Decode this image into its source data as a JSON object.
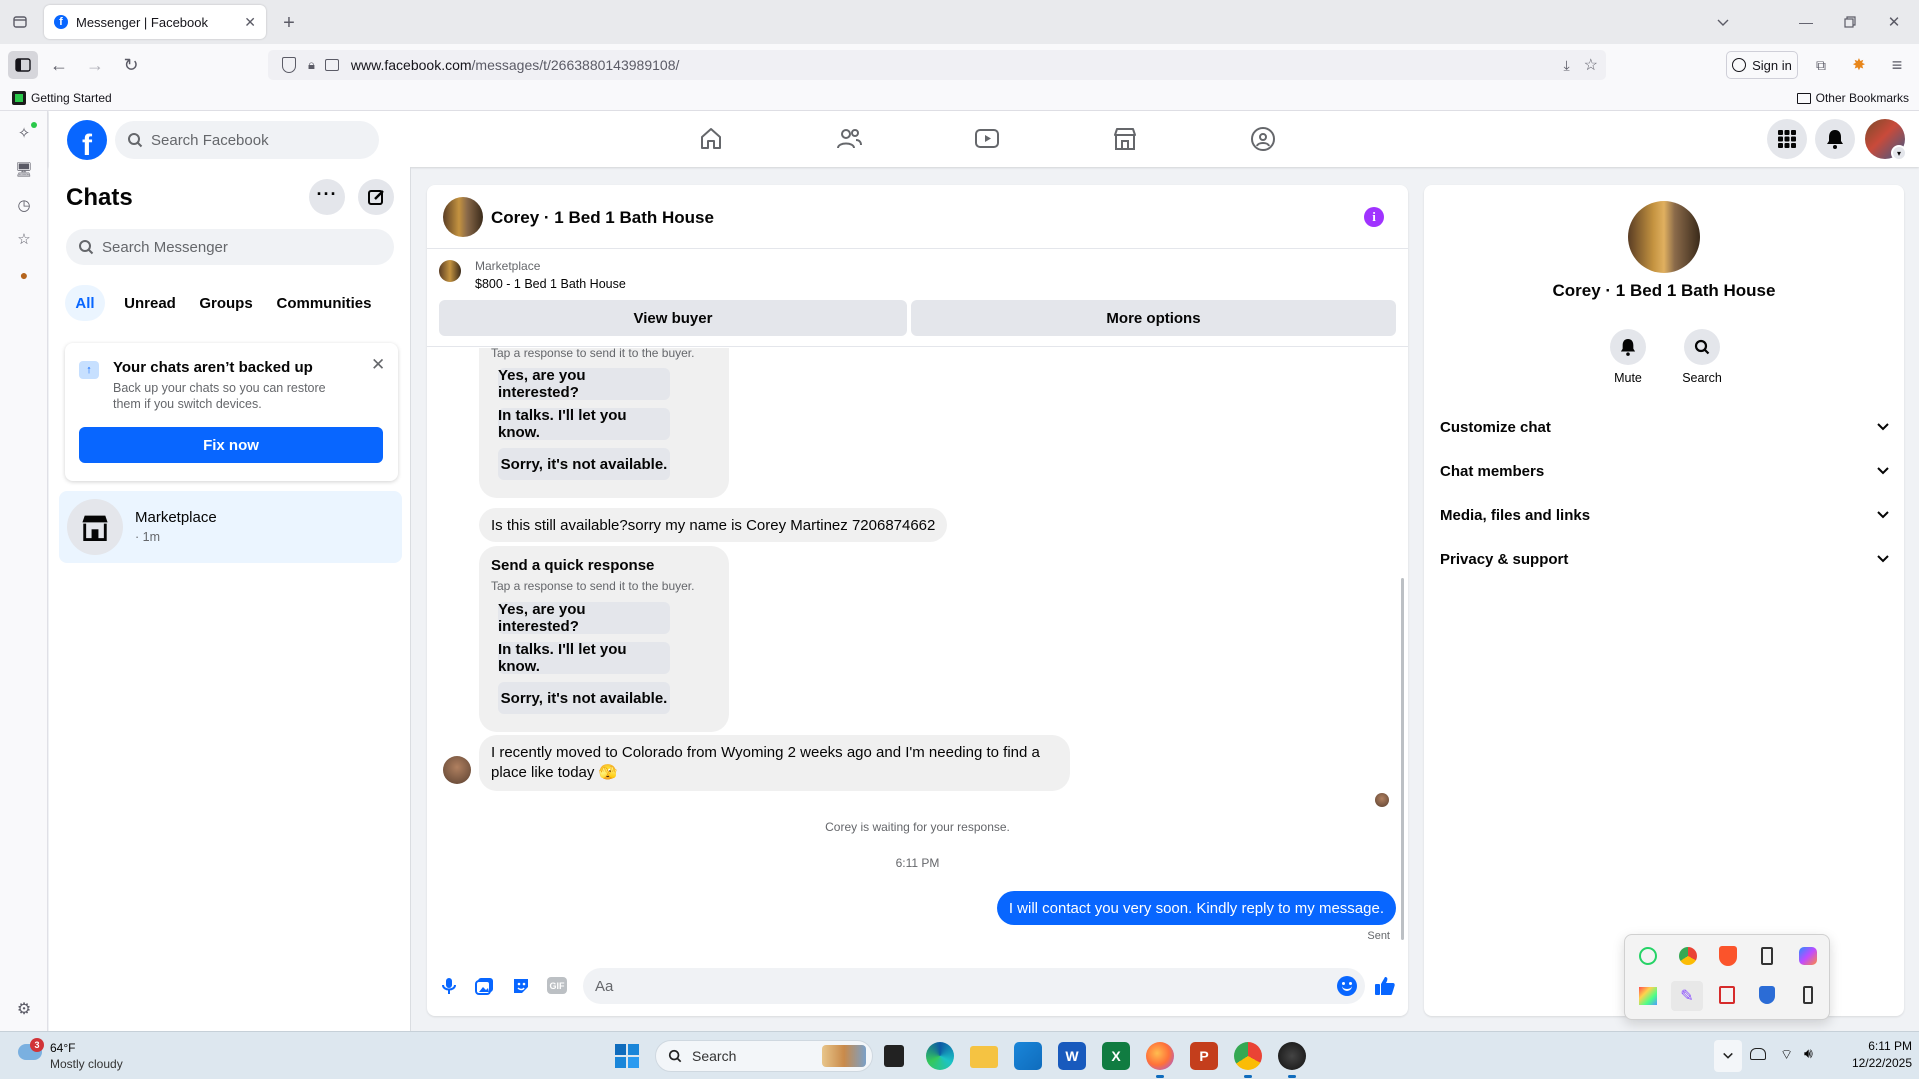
{
  "browser": {
    "tab_title": "Messenger | Facebook",
    "url_host": "www.facebook.com",
    "url_path": "/messages/t/2663880143989108/",
    "sign_in": "Sign in",
    "bookmark_getting_started": "Getting Started",
    "other_bookmarks": "Other Bookmarks"
  },
  "fb": {
    "search_placeholder": "Search Facebook"
  },
  "chats": {
    "title": "Chats",
    "search_placeholder": "Search Messenger",
    "filters": [
      "All",
      "Unread",
      "Groups",
      "Communities"
    ],
    "backup": {
      "title": "Your chats aren’t backed up",
      "body": "Back up your chats so you can restore them if you switch devices.",
      "button": "Fix now"
    },
    "items": [
      {
        "name": "Marketplace",
        "meta": "· 1m"
      }
    ]
  },
  "conversation": {
    "title": "Corey · 1 Bed 1 Bath House",
    "marketplace_label": "Marketplace",
    "listing": "$800 - 1 Bed 1 Bath House",
    "view_buyer": "View buyer",
    "more_options": "More options",
    "qr_hint": "Tap a response to send it to the buyer.",
    "qr_title": "Send a quick response",
    "qr_options": [
      "Yes, are you interested?",
      "In talks. I'll let you know.",
      "Sorry, it's not available."
    ],
    "msg_available": "Is this still available?sorry my name is Corey Martinez 7206874662",
    "msg_moved": "I recently moved to Colorado from Wyoming 2 weeks ago and I'm needing to find a place like today 🫣",
    "waiting": "Corey is waiting for your response.",
    "time": "6:11 PM",
    "my_message": "I will contact you very soon. Kindly reply to my message.",
    "sent": "Sent",
    "composer_placeholder": "Aa"
  },
  "details": {
    "name": "Corey · 1 Bed 1 Bath House",
    "mute": "Mute",
    "search": "Search",
    "sections": [
      "Customize chat",
      "Chat members",
      "Media, files and links",
      "Privacy & support"
    ]
  },
  "taskbar": {
    "weather_temp": "64°F",
    "weather_desc": "Mostly cloudy",
    "weather_badge": "3",
    "search": "Search",
    "time": "6:11 PM",
    "date": "12/22/2025"
  },
  "colors": {
    "fb_blue": "#0866ff",
    "messenger_purple": "#a033ff"
  }
}
